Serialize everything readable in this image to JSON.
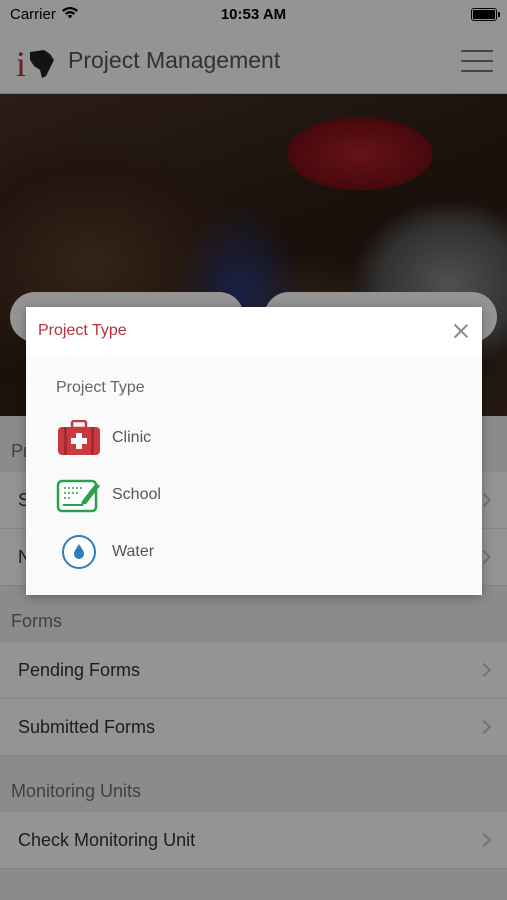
{
  "status_bar": {
    "carrier": "Carrier",
    "time": "10:53 AM"
  },
  "nav": {
    "title": "Project Management",
    "logo_letter": "i"
  },
  "list": {
    "sections": [
      {
        "header": "Pr",
        "rows": [
          "S",
          "N"
        ]
      },
      {
        "header": "Forms",
        "rows": [
          "Pending Forms",
          "Submitted Forms"
        ]
      },
      {
        "header": "Monitoring Units",
        "rows": [
          "Check Monitoring Unit"
        ]
      }
    ]
  },
  "modal": {
    "title": "Project Type",
    "subtitle": "Project Type",
    "options": [
      {
        "label": "Clinic",
        "icon": "first-aid-kit-icon",
        "color": "#c9393f"
      },
      {
        "label": "School",
        "icon": "chalkboard-pencil-icon",
        "color": "#2aa14a"
      },
      {
        "label": "Water",
        "icon": "water-drop-icon",
        "color": "#2a7fbf"
      }
    ]
  },
  "colors": {
    "brand": "#b2323b",
    "accent_blue": "#2a7fbf",
    "accent_green": "#2aa14a"
  }
}
